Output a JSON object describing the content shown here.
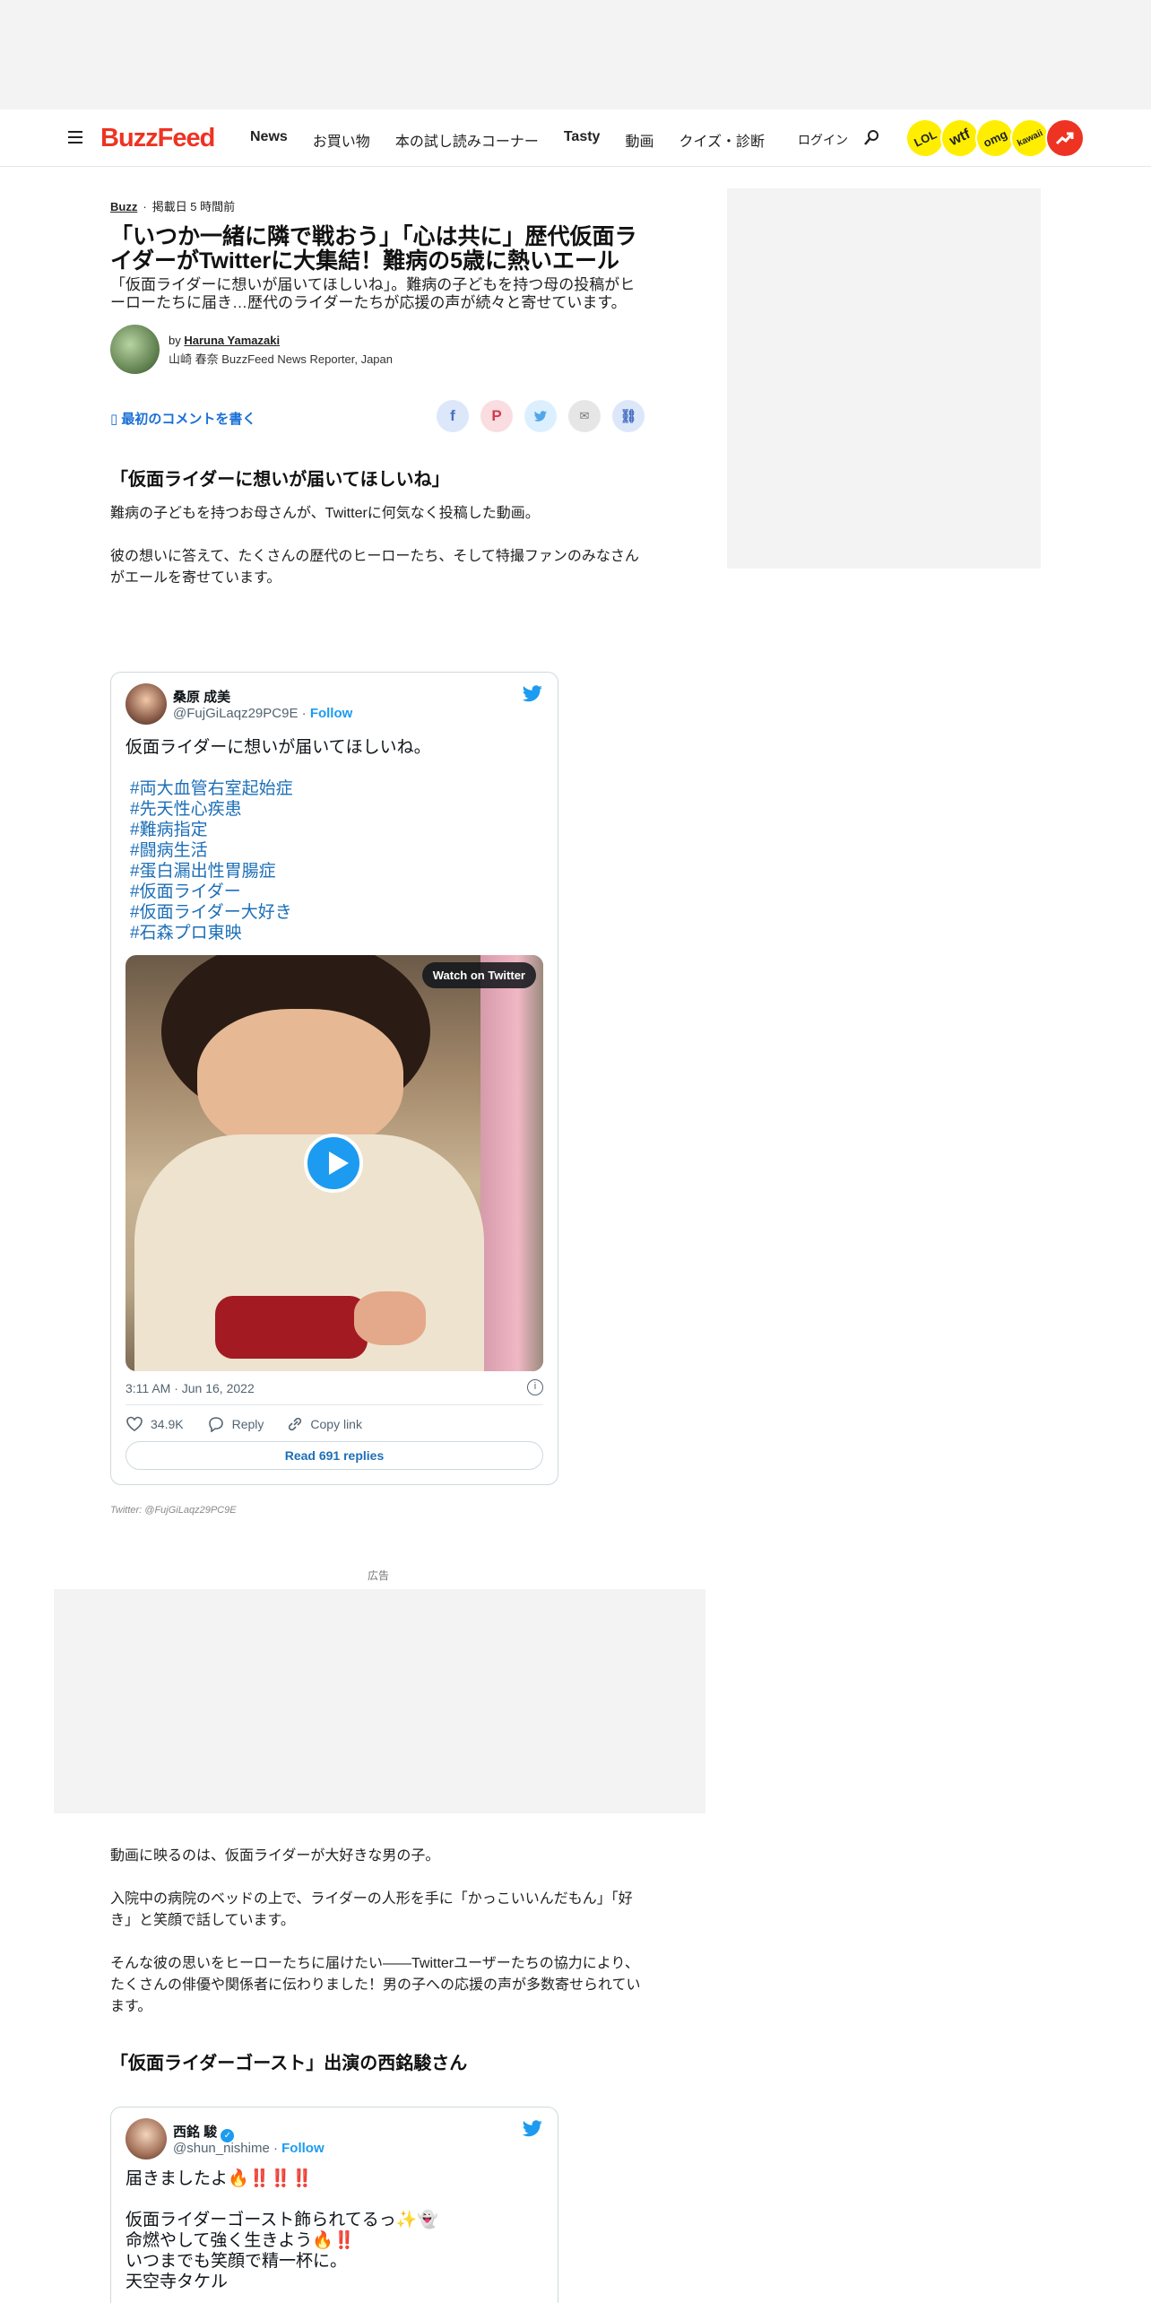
{
  "nav": {
    "logo": "BuzzFeed",
    "links": [
      "News",
      "お買い物",
      "本の試し読みコーナー",
      "Tasty",
      "動画",
      "クイズ・診断"
    ],
    "login": "ログイン",
    "badges": [
      "LOL",
      "wtf",
      "omg",
      "kawaii"
    ]
  },
  "article": {
    "category": "Buzz",
    "posted": "掲載日 5 時間前",
    "title": "「いつか一緒に隣で戦おう」「心は共に」歴代仮面ライダーがTwitterに大集結！難病の5歳に熱いエール",
    "lede": "「仮面ライダーに想いが届いてほしいね」。難病の子どもを持つ母の投稿がヒーローたちに届き…歴代のライダーたちが応援の声が続々と寄せています。",
    "byline_prefix": "by",
    "author": "Haruna Yamazaki",
    "author_role": "山崎 春奈 BuzzFeed News Reporter, Japan",
    "comment_link": "最初のコメントを書く",
    "section1_heading": "「仮面ライダーに想いが届いてほしいね」",
    "para1": "難病の子どもを持つお母さんが、Twitterに何気なく投稿した動画。",
    "para2": "彼の想いに答えて、たくさんの歴代のヒーローたち、そして特撮ファンのみなさんがエールを寄せています。",
    "credit": "Twitter: @FujGiLaqz29PC9E",
    "ad_label": "広告",
    "para3": "動画に映るのは、仮面ライダーが大好きな男の子。",
    "para4": "入院中の病院のベッドの上で、ライダーの人形を手に「かっこいいんだもん」「好き」と笑顔で話しています。",
    "para5": "そんな彼の思いをヒーローたちに届けたい――Twitterユーザーたちの協力により、たくさんの俳優や関係者に伝わりました！男の子への応援の声が多数寄せられています。",
    "section2_heading": "「仮面ライダーゴースト」出演の西銘駿さん"
  },
  "tweet1": {
    "name": "桑原 成美",
    "handle": "@FujGiLaqz29PC9E",
    "follow": "Follow",
    "text": "仮面ライダーに想いが届いてほしいね。",
    "tags": [
      "#両大血管右室起始症",
      "#先天性心疾患",
      "#難病指定",
      "#闘病生活",
      "#蛋白漏出性胃腸症",
      "#仮面ライダー",
      "#仮面ライダー大好き",
      "#石森プロ東映"
    ],
    "watch": "Watch on Twitter",
    "time": "3:11 AM · Jun 16, 2022",
    "likes": "34.9K",
    "reply": "Reply",
    "copy": "Copy link",
    "read_replies": "Read 691 replies"
  },
  "tweet2": {
    "name": "西銘 駿",
    "handle": "@shun_nishime",
    "follow": "Follow",
    "lines": [
      "届きましたよ🔥‼️‼️‼️",
      "",
      "仮面ライダーゴースト飾られてるっ✨👻",
      "命燃やして強く生きよう🔥‼️",
      "いつまでも笑顔で精一杯に。",
      "天空寺タケル"
    ]
  },
  "colors": {
    "brand": "#ee3322",
    "link": "#1a6fd6",
    "twitter": "#1d9bf0",
    "ad_bg": "#f3f3f3"
  }
}
